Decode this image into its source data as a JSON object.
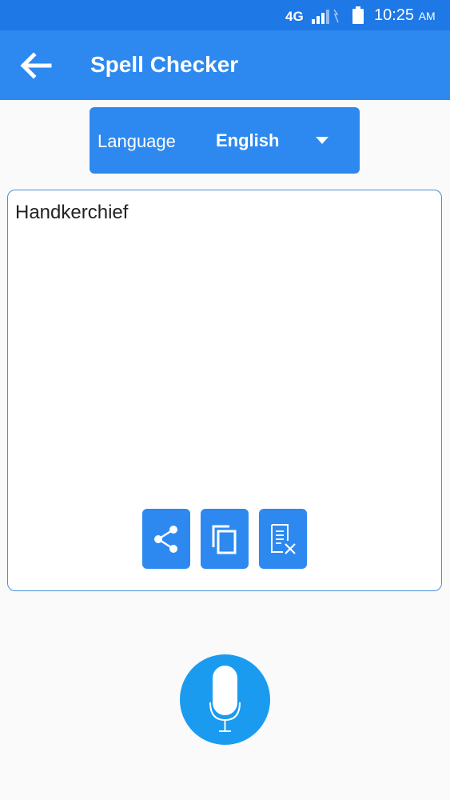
{
  "status_bar": {
    "network": "4G",
    "time": "10:25",
    "ampm": "AM",
    "icons": [
      "signal-icon",
      "battery-icon"
    ]
  },
  "app_bar": {
    "title": "Spell Checker",
    "back_icon": "arrow-left-icon"
  },
  "language_selector": {
    "label": "Language",
    "selected": "English",
    "dropdown_icon": "caret-down-icon"
  },
  "editor": {
    "text": "Handkerchief",
    "actions": [
      {
        "name": "share",
        "icon": "share-icon"
      },
      {
        "name": "copy",
        "icon": "copy-icon"
      },
      {
        "name": "clear",
        "icon": "clear-text-icon"
      }
    ]
  },
  "mic": {
    "icon": "microphone-icon"
  },
  "colors": {
    "primary": "#2d89ef",
    "status_bar": "#1e78e6",
    "mic": "#1a9bf0",
    "border": "#4a90d9"
  }
}
